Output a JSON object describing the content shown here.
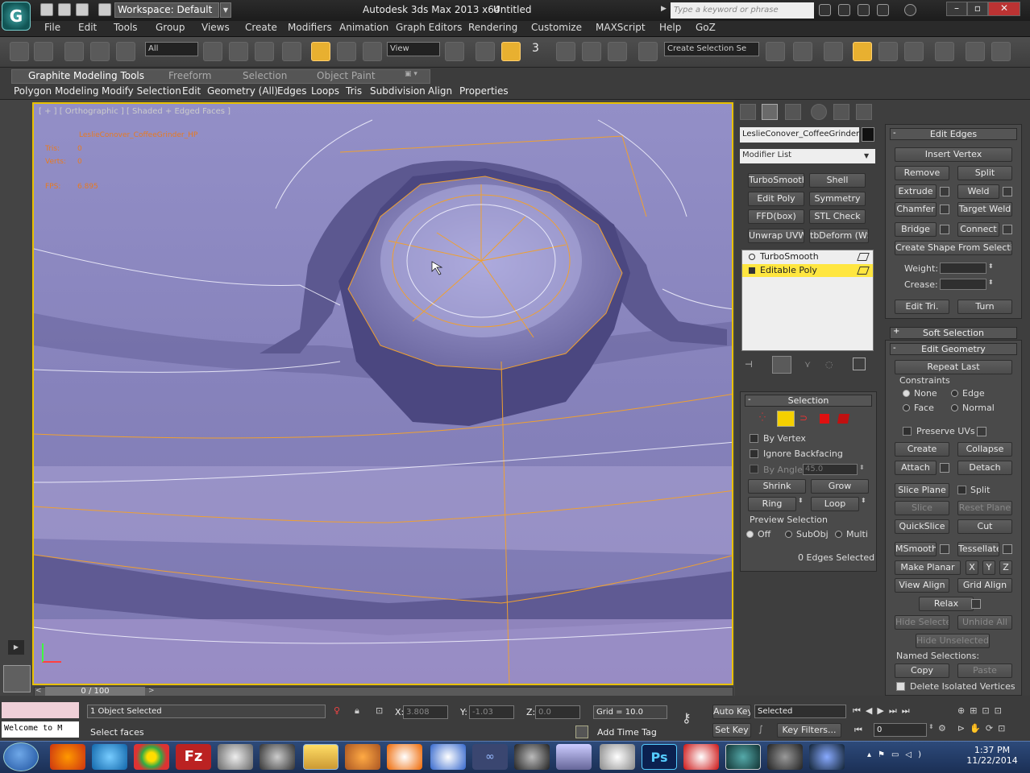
{
  "titlebar": {
    "workspace": "Workspace: Default",
    "app_title": "Autodesk 3ds Max  2013 x64",
    "doc_title": "Untitled",
    "search_placeholder": "Type a keyword or phrase"
  },
  "menu": [
    "File",
    "Edit",
    "Tools",
    "Group",
    "Views",
    "Create",
    "Modifiers",
    "Animation",
    "Graph Editors",
    "Rendering",
    "Customize",
    "MAXScript",
    "Help",
    "GoZ"
  ],
  "toolbar": {
    "selection_filter": "All",
    "ref_coord": "View",
    "named_selection": "Create Selection Se",
    "snap_count": "3"
  },
  "ribbon": {
    "tabs": [
      "Graphite Modeling Tools",
      "Freeform",
      "Selection",
      "Object Paint"
    ],
    "panels": [
      "Polygon Modeling",
      "Modify Selection",
      "Edit",
      "Geometry (All)",
      "Edges",
      "Loops",
      "Tris",
      "Subdivision",
      "Align",
      "Properties"
    ]
  },
  "viewport": {
    "label": "[ + ] [ Orthographic ] [ Shaded + Edged Faces ]",
    "object_name": "LeslieConover_CoffeeGrinder_HP",
    "tris_label": "Tris:",
    "tris_value": "0",
    "verts_label": "Verts:",
    "verts_value": "0",
    "fps_label": "FPS:",
    "fps_value": "6.895"
  },
  "command_panel": {
    "object_name": "LeslieConover_CoffeeGrinder",
    "modifier_list": "Modifier List",
    "modifier_buttons": [
      "TurboSmooth",
      "Shell",
      "Edit Poly",
      "Symmetry",
      "FFD(box)",
      "STL Check",
      "Unwrap UVW",
      "tbDeform (WSI"
    ],
    "stack": [
      {
        "name": "TurboSmooth",
        "selected": false
      },
      {
        "name": "Editable Poly",
        "selected": true
      }
    ],
    "selection": {
      "title": "Selection",
      "by_vertex": "By Vertex",
      "ignore_backfacing": "Ignore Backfacing",
      "by_angle": "By Angle:",
      "angle_value": "45.0",
      "shrink": "Shrink",
      "grow": "Grow",
      "ring": "Ring",
      "loop": "Loop",
      "preview_selection": "Preview Selection",
      "off": "Off",
      "subobj": "SubObj",
      "multi": "Multi",
      "status": "0 Edges Selected"
    }
  },
  "edit_edges": {
    "title": "Edit Edges",
    "insert_vertex": "Insert Vertex",
    "remove": "Remove",
    "split": "Split",
    "extrude": "Extrude",
    "weld": "Weld",
    "chamfer": "Chamfer",
    "target_weld": "Target Weld",
    "bridge": "Bridge",
    "connect": "Connect",
    "create_shape": "Create Shape From Selection",
    "weight": "Weight:",
    "crease": "Crease:",
    "edit_tri": "Edit Tri.",
    "turn": "Turn"
  },
  "soft_selection": {
    "title": "Soft Selection"
  },
  "edit_geometry": {
    "title": "Edit Geometry",
    "repeat_last": "Repeat Last",
    "constraints": "Constraints",
    "none": "None",
    "edge": "Edge",
    "face": "Face",
    "normal": "Normal",
    "preserve_uvs": "Preserve UVs",
    "create": "Create",
    "collapse": "Collapse",
    "attach": "Attach",
    "detach": "Detach",
    "slice_plane": "Slice Plane",
    "split": "Split",
    "slice": "Slice",
    "reset_plane": "Reset Plane",
    "quickslice": "QuickSlice",
    "cut": "Cut",
    "msmooth": "MSmooth",
    "tessellate": "Tessellate",
    "make_planar": "Make Planar",
    "x": "X",
    "y": "Y",
    "z": "Z",
    "view_align": "View Align",
    "grid_align": "Grid Align",
    "relax": "Relax",
    "hide_selected": "Hide Selected",
    "unhide_all": "Unhide All",
    "hide_unselected": "Hide Unselected",
    "named_selections": "Named Selections:",
    "copy": "Copy",
    "paste": "Paste",
    "delete_isolated": "Delete Isolated Vertices"
  },
  "status": {
    "frame": "0 / 100",
    "objects_selected": "1 Object Selected",
    "prompt": "Select faces",
    "listener": "Welcome to M",
    "x_label": "X:",
    "x_value": "3.808",
    "y_label": "Y:",
    "y_value": "-1.03",
    "z_label": "Z:",
    "z_value": "0.0",
    "grid": "Grid = 10.0",
    "add_time_tag": "Add Time Tag",
    "auto_key": "Auto Key",
    "set_key": "Set Key",
    "key_mode": "Selected",
    "key_filters": "Key Filters...",
    "current_frame": "0"
  },
  "taskbar": {
    "time": "1:37 PM",
    "date": "11/22/2014"
  }
}
